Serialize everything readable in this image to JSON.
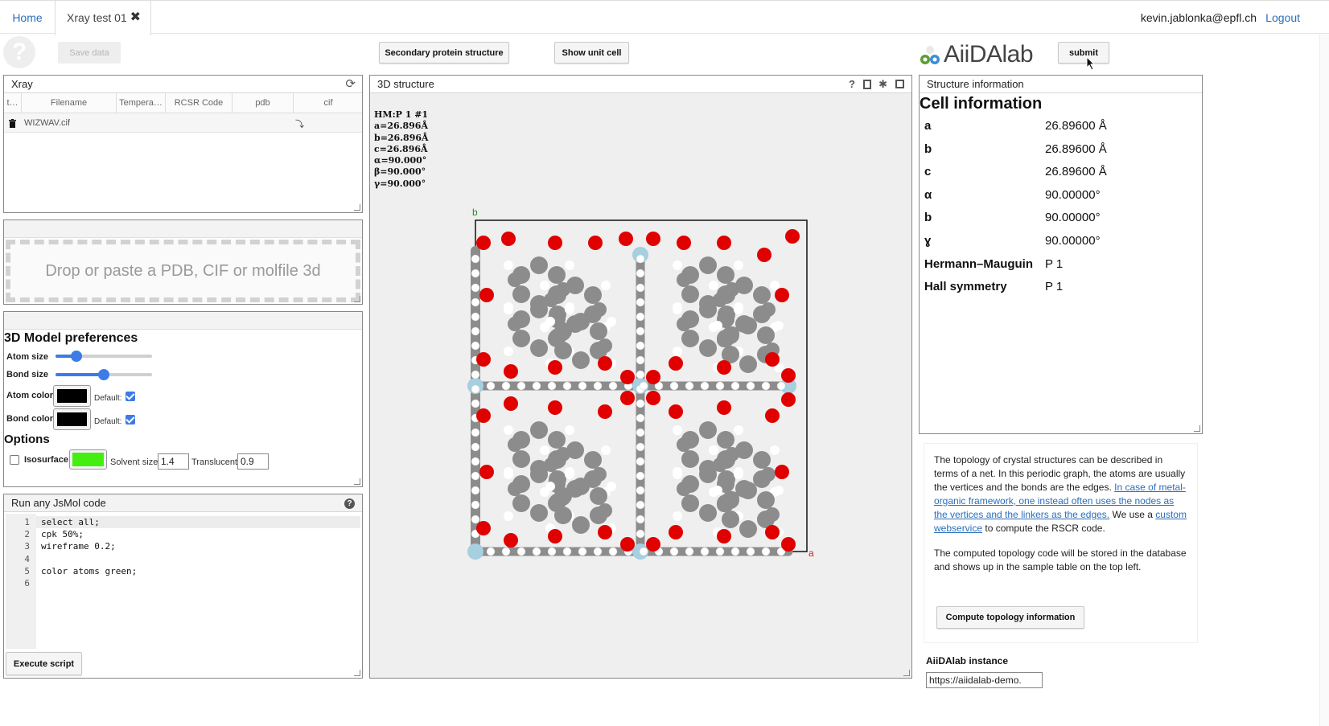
{
  "tabs": {
    "home": "Home",
    "current": "Xray test 01",
    "close": "✖"
  },
  "user": {
    "email": "kevin.jablonka@epfl.ch",
    "logout": "Logout"
  },
  "toolbar": {
    "save": "Save data",
    "secondary": "Secondary protein structure",
    "unit_cell": "Show unit cell",
    "submit": "submit",
    "logo_text": "AiiDAlab"
  },
  "xray_panel": {
    "title": "Xray",
    "columns": [
      "t…",
      "Filename",
      "Tempera…",
      "RCSR Code",
      "pdb",
      "cif"
    ],
    "rows": [
      {
        "filename": "WIZWAV.cif"
      }
    ]
  },
  "drop": {
    "text": "Drop or paste a PDB, CIF or molfile 3d"
  },
  "prefs": {
    "title": "3D Model preferences",
    "atom_size": {
      "label": "Atom size",
      "value": 0.22
    },
    "bond_size": {
      "label": "Bond size",
      "value": 0.5
    },
    "atom_color": {
      "label": "Atom color",
      "color": "#000000",
      "default_label": "Default:",
      "default": true
    },
    "bond_color": {
      "label": "Bond color",
      "color": "#000000",
      "default_label": "Default:",
      "default": true
    },
    "options_title": "Options",
    "isosurface": {
      "label": "Isosurface",
      "checked": false,
      "color": "#44ee11"
    },
    "solvent_label": "Solvent size:",
    "solvent_value": "1.4",
    "translucent_label": "Translucent:",
    "translucent_value": "0.9"
  },
  "jsmol": {
    "title": "Run any JsMol code",
    "lines": [
      "select all;",
      "cpk 50%;",
      "wireframe 0.2;",
      "",
      "color atoms green;",
      ""
    ],
    "execute": "Execute script"
  },
  "structure3d": {
    "title": "3D structure",
    "cell_text": [
      "HM:P 1 #1",
      "a=26.896Å",
      "b=26.896Å",
      "c=26.896Å",
      "α=90.000°",
      "β=90.000°",
      "γ=90.000°"
    ],
    "axis_b": "b",
    "axis_a": "a",
    "colors": {
      "oxygen": "#e00000",
      "carbon": "#8c8c8c",
      "hydrogen": "#ffffff",
      "metal": "#a6cfe0"
    }
  },
  "structure_info": {
    "title": "Structure information",
    "heading": "Cell information",
    "rows": [
      {
        "key": "a",
        "value": "26.89600 Å"
      },
      {
        "key": "b",
        "value": "26.89600 Å"
      },
      {
        "key": "c",
        "value": "26.89600 Å"
      },
      {
        "key": "α",
        "value": "90.00000°"
      },
      {
        "key": "b",
        "value": "90.00000°"
      },
      {
        "key": "ɣ",
        "value": "90.00000°"
      },
      {
        "key": "Hermann–Mauguin",
        "value": "P 1"
      },
      {
        "key": "Hall symmetry",
        "value": "P 1"
      }
    ]
  },
  "topology": {
    "p1_a": "The topology of crystal structures can be described in terms of a net. In this periodic graph, the atoms are usually the vertices and the bonds are the edges. ",
    "p1_link": "In case of metal-organic framework, one instead often uses the nodes as the vertices and the linkers as the edges.",
    "p1_b": " We use a ",
    "p1_link2": "custom webservice",
    "p1_c": " to compute the RSCR code.",
    "p2": "The computed topology code will be stored in the database and shows up in the sample table on the top left.",
    "button": "Compute topology information"
  },
  "instance": {
    "label": "AiiDAlab instance",
    "value": "https://aiidalab-demo."
  }
}
